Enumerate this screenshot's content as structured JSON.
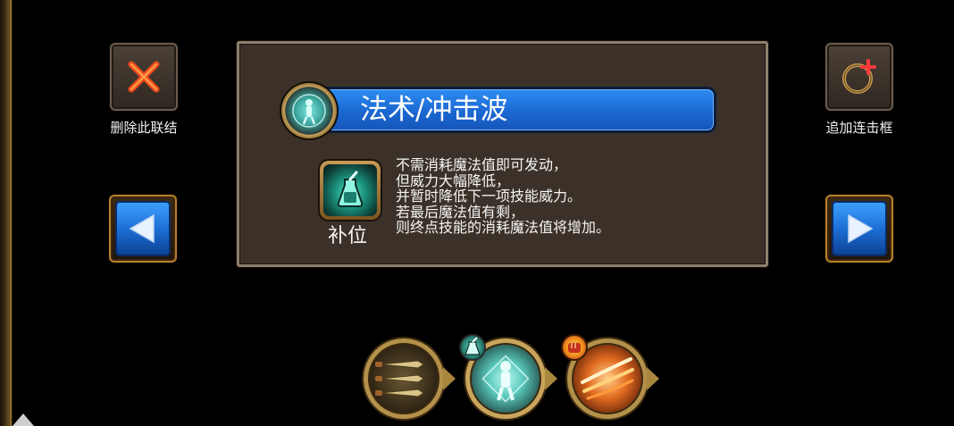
{
  "left_panel": {
    "delete_link_label": "删除此联结"
  },
  "right_panel": {
    "add_combo_label": "追加连击框"
  },
  "skill_card": {
    "title": "法术/冲击波",
    "modifier_label": "补位",
    "description_lines": [
      "不需消耗魔法值即可发动，",
      "但威力大幅降低，",
      "并暂时降低下一项技能威力。",
      "若最后魔法值有剩，",
      "则终点技能的消耗魔法值将增加。"
    ]
  },
  "chain": {
    "nodes": [
      {
        "icon": "daggers-icon",
        "selected": false
      },
      {
        "icon": "spirit-figure-icon",
        "selected": true,
        "badge": "flask-icon"
      },
      {
        "icon": "fire-slash-icon",
        "selected": false,
        "badge": "fist-icon"
      }
    ]
  },
  "colors": {
    "title_bar": "#1b68d2",
    "arrow_button": "#1d6fd6",
    "panel_bg": "#3b3128",
    "gold_frame": "#b4914b"
  }
}
